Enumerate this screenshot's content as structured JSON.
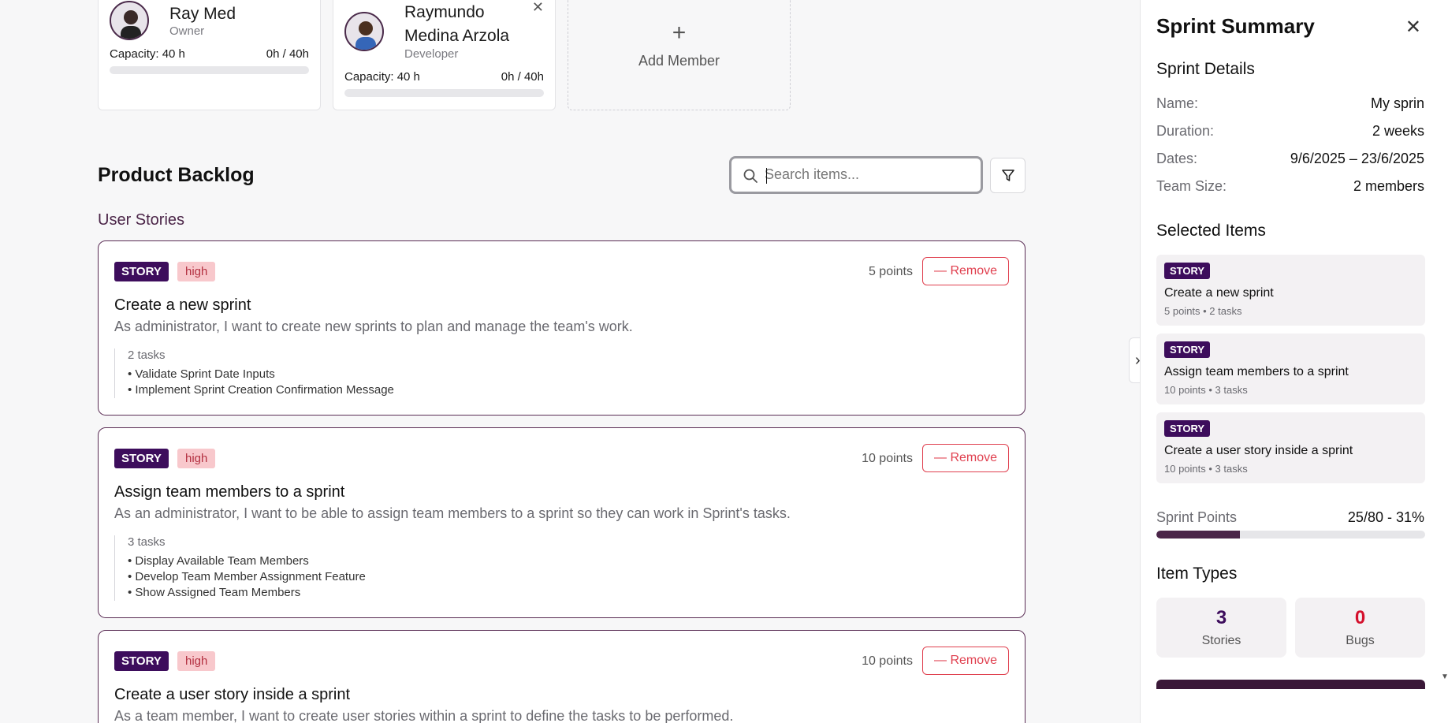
{
  "members": [
    {
      "name_lines": [
        "Ray Med"
      ],
      "role": "Owner",
      "capacity_label": "Capacity: 40 h",
      "capacity_value": "0h / 40h"
    },
    {
      "name_lines": [
        "Raymundo",
        "Medina Arzola"
      ],
      "role": "Developer",
      "capacity_label": "Capacity: 40 h",
      "capacity_value": "0h / 40h"
    }
  ],
  "add_member": {
    "plus": "+",
    "label": "Add Member"
  },
  "backlog": {
    "title": "Product Backlog",
    "search_placeholder": "Search items...",
    "section_label": "User Stories",
    "stories": [
      {
        "type": "STORY",
        "priority": "high",
        "points": "5 points",
        "remove_label": "Remove",
        "title": "Create a new sprint",
        "description": "As administrator, I want to create new sprints to plan and manage the team's work.",
        "task_count": "2 tasks",
        "tasks": [
          "• Validate Sprint Date Inputs",
          "• Implement Sprint Creation Confirmation Message"
        ]
      },
      {
        "type": "STORY",
        "priority": "high",
        "points": "10 points",
        "remove_label": "Remove",
        "title": "Assign team members to a sprint",
        "description": "As an administrator, I want to be able to assign team members to a sprint so they can work in Sprint's tasks.",
        "task_count": "3 tasks",
        "tasks": [
          "• Display Available Team Members",
          "• Develop Team Member Assignment Feature",
          "• Show Assigned Team Members"
        ]
      },
      {
        "type": "STORY",
        "priority": "high",
        "points": "10 points",
        "remove_label": "Remove",
        "title": "Create a user story inside a sprint",
        "description": "As a team member, I want to create user stories within a sprint to define the tasks to be performed.",
        "task_count": "",
        "tasks": []
      }
    ]
  },
  "panel": {
    "title": "Sprint Summary",
    "close": "✕",
    "details_heading": "Sprint Details",
    "details": [
      {
        "label": "Name:",
        "value": "My sprin"
      },
      {
        "label": "Duration:",
        "value": "2 weeks"
      },
      {
        "label": "Dates:",
        "value": "9/6/2025 – 23/6/2025"
      },
      {
        "label": "Team Size:",
        "value": "2 members"
      }
    ],
    "selected_heading": "Selected Items",
    "selected": [
      {
        "badge": "STORY",
        "title": "Create a new sprint",
        "meta": "5 points • 2 tasks"
      },
      {
        "badge": "STORY",
        "title": "Assign team members to a sprint",
        "meta": "10 points • 3 tasks"
      },
      {
        "badge": "STORY",
        "title": "Create a user story inside a sprint",
        "meta": "10 points • 3 tasks"
      }
    ],
    "sprint_points_label": "Sprint Points",
    "sprint_points_value": "25/80 - 31%",
    "sprint_points_fraction": 0.31,
    "types_heading": "Item Types",
    "types": [
      {
        "count": "3",
        "label": "Stories",
        "color": "#3d0d5c"
      },
      {
        "count": "0",
        "label": "Bugs",
        "color": "#d4102c"
      }
    ]
  }
}
